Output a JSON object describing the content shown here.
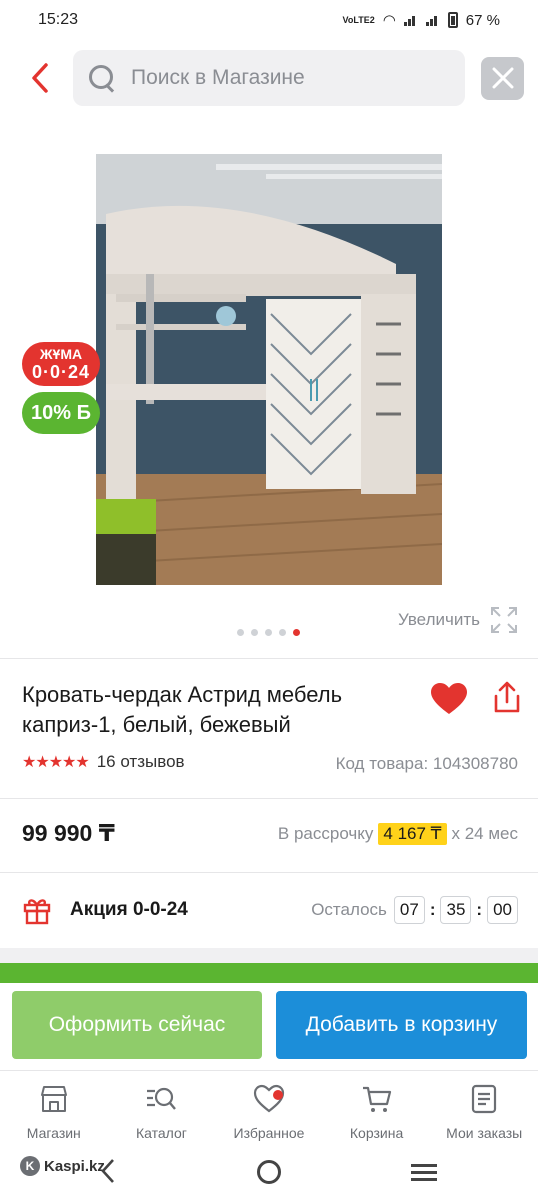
{
  "status_bar": {
    "time": "15:23",
    "network": "VoLTE2",
    "battery": "67 %"
  },
  "search": {
    "placeholder": "Поиск в Магазине"
  },
  "badges": {
    "promo_top": "ЖҰМА",
    "promo_bottom": "0·0·24",
    "bonus": "10% Б"
  },
  "gallery": {
    "zoom_label": "Увеличить",
    "dots_total": 5,
    "active_dot": 5
  },
  "product": {
    "title": "Кровать-чердак Астрид мебель каприз-1, белый, бежевый",
    "rating_stars": 5,
    "reviews": "16 отзывов",
    "sku": "Код товара: 104308780",
    "price": "99 990 ₸",
    "installment_prefix": "В рассрочку",
    "installment_amount": "4 167 ₸",
    "installment_suffix": "x 24 мес"
  },
  "promo": {
    "label": "Акция 0-0-24",
    "remaining_label": "Осталось",
    "hours": "07",
    "minutes": "35",
    "seconds": "00"
  },
  "actions": {
    "checkout": "Оформить сейчас",
    "add_to_cart": "Добавить в корзину"
  },
  "tabs": [
    {
      "label": "Магазин",
      "icon": "store-icon"
    },
    {
      "label": "Каталог",
      "icon": "catalog-icon"
    },
    {
      "label": "Избранное",
      "icon": "heart-icon"
    },
    {
      "label": "Корзина",
      "icon": "cart-icon"
    },
    {
      "label": "Мои заказы",
      "icon": "orders-icon"
    }
  ],
  "watermark": "Kaspi.kz",
  "colors": {
    "accent_red": "#e3342f",
    "green": "#5bb531",
    "blue": "#1c8ed9",
    "highlight_yellow": "#ffd21a"
  }
}
